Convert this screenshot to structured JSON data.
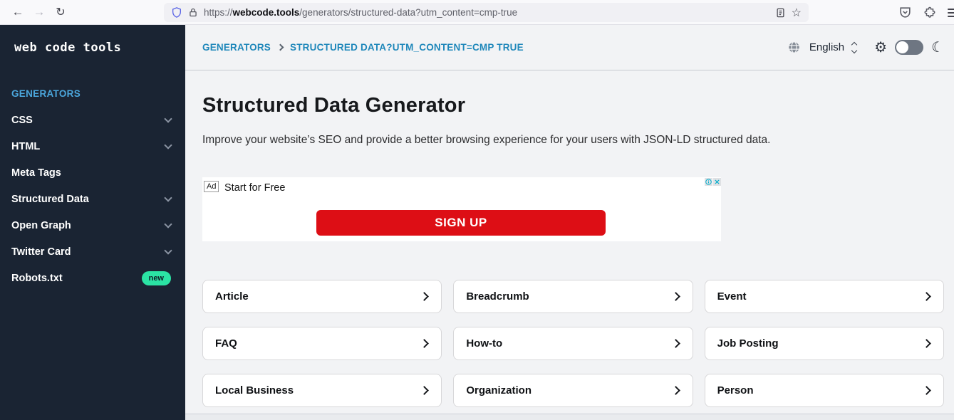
{
  "browser": {
    "url": {
      "prefix": "https://",
      "domain": "webcode.tools",
      "path": "/generators/structured-data?utm_content=cmp-true"
    },
    "icons": {
      "back": "←",
      "forward": "→",
      "refresh": "↻",
      "star": "☆"
    }
  },
  "sidebar": {
    "logo": "web code tools",
    "section_label": "GENERATORS",
    "items": [
      {
        "label": "CSS"
      },
      {
        "label": "HTML"
      },
      {
        "label": "Meta Tags"
      },
      {
        "label": "Structured Data"
      },
      {
        "label": "Open Graph"
      },
      {
        "label": "Twitter Card"
      },
      {
        "label": "Robots.txt",
        "badge": "new"
      }
    ]
  },
  "header": {
    "breadcrumb": {
      "root": "GENERATORS",
      "current": "STRUCTURED DATA?UTM_CONTENT=CMP TRUE"
    },
    "language_label": "English",
    "icons": {
      "gear": "⚙",
      "moon": "☾"
    }
  },
  "main": {
    "title": "Structured Data Generator",
    "subtitle": "Improve your website’s SEO and provide a better browsing experience for your users with JSON-LD structured data.",
    "ad": {
      "label": "Ad",
      "text": "Start for Free",
      "button_label": "SIGN UP"
    },
    "cards": [
      "Article",
      "Breadcrumb",
      "Event",
      "FAQ",
      "How-to",
      "Job Posting",
      "Local Business",
      "Organization",
      "Person"
    ]
  },
  "colors": {
    "sidebar_bg": "#1a2433",
    "accent_blue": "#4ba7dd",
    "breadcrumb_blue": "#1e87ba",
    "ad_red": "#dd0e15",
    "badge_green": "#2be3a4",
    "main_bg": "#f2f3f5"
  }
}
